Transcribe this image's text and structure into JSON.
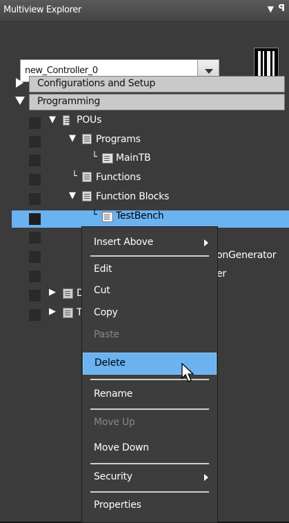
{
  "panel": {
    "title": "Multiview Explorer",
    "pin_icon": "▼",
    "pin2_icon": "ꟼ",
    "controller_dropdown_value": "new_Controller_0"
  },
  "tree": {
    "configurations": "Configurations and Setup",
    "programming": "Programming",
    "pous": "POUs",
    "programs": "Programs",
    "main_tb": "MainTB",
    "functions": "Functions",
    "function_blocks": "Function Blocks",
    "test_bench": "TestBench",
    "partial_generator": "onGenerator",
    "partial_er": "er",
    "data_partial": "Da",
    "tasks_partial": "Ta"
  },
  "context_menu": {
    "insert_above": "Insert Above",
    "edit": "Edit",
    "cut": "Cut",
    "copy": "Copy",
    "paste": "Paste",
    "delete": "Delete",
    "rename": "Rename",
    "move_up": "Move Up",
    "move_down": "Move Down",
    "security": "Security",
    "properties": "Properties"
  },
  "colors": {
    "selection": "#6ab2f0",
    "panel_bg": "#3b3b3b",
    "header_bg": "#c9c9c9"
  }
}
